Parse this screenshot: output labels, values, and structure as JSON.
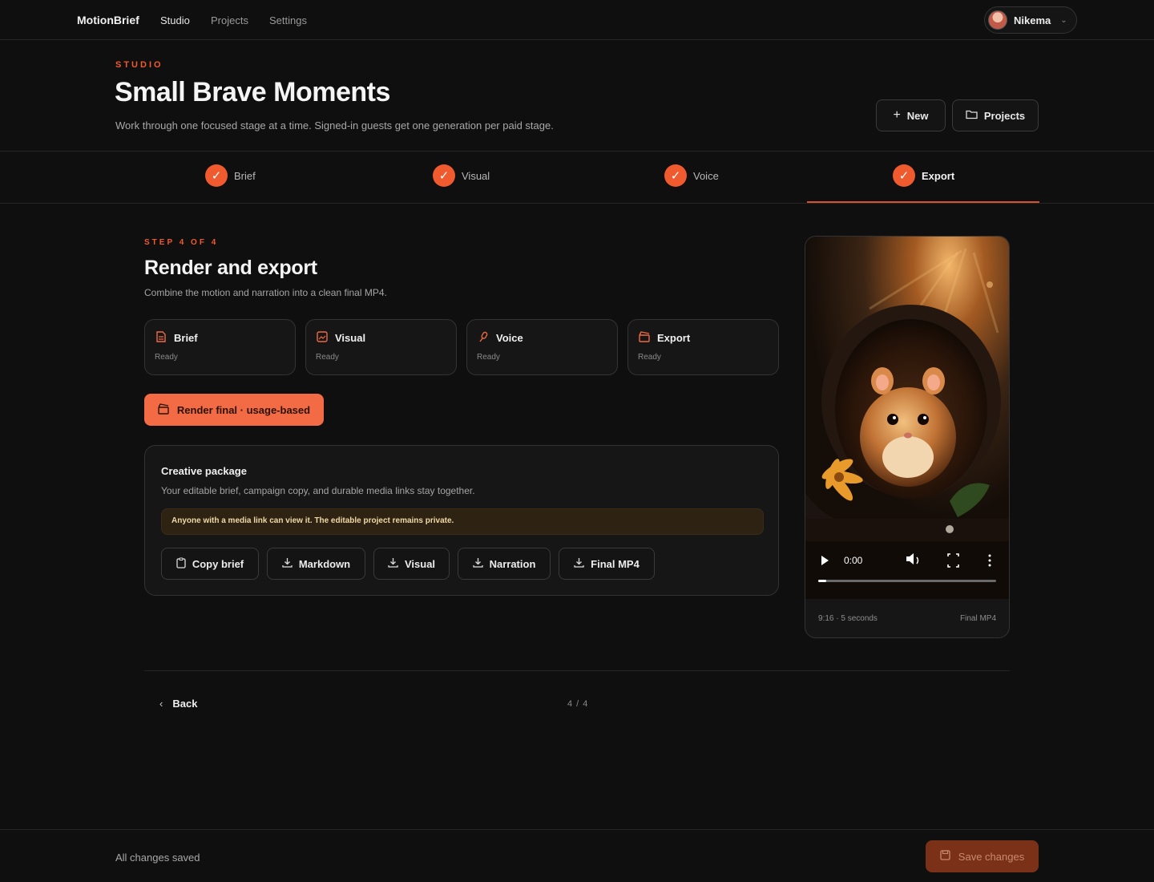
{
  "nav": {
    "brand": "MotionBrief",
    "links": [
      "Studio",
      "Projects",
      "Settings"
    ],
    "user": {
      "name": "Nikema"
    }
  },
  "header": {
    "eyebrow": "STUDIO",
    "title": "Small Brave Moments",
    "subtitle": "Work through one focused stage at a time. Signed-in guests get one generation per paid stage.",
    "new_label": "New",
    "projects_label": "Projects"
  },
  "steps": [
    {
      "label": "Brief"
    },
    {
      "label": "Visual"
    },
    {
      "label": "Voice"
    },
    {
      "label": "Export"
    }
  ],
  "main": {
    "eyebrow": "STEP 4 OF 4",
    "title": "Render and export",
    "description": "Combine the motion and narration into a clean final MP4.",
    "cards": [
      {
        "label": "Brief",
        "status": "Ready",
        "icon": "document-icon"
      },
      {
        "label": "Visual",
        "status": "Ready",
        "icon": "image-icon"
      },
      {
        "label": "Voice",
        "status": "Ready",
        "icon": "microphone-icon"
      },
      {
        "label": "Export",
        "status": "Ready",
        "icon": "clapperboard-icon"
      }
    ],
    "render_label": "Render final · usage-based",
    "package": {
      "title": "Creative package",
      "description": "Your editable brief, campaign copy, and durable media links stay together.",
      "notice": "Anyone with a media link can view it. The editable project remains private.",
      "buttons": [
        "Copy brief",
        "Markdown",
        "Visual",
        "Narration",
        "Final MP4"
      ]
    }
  },
  "video": {
    "time": "0:00",
    "meta_left": "9:16 · 5 seconds",
    "meta_right": "Final MP4"
  },
  "pager": {
    "back_label": "Back",
    "position": "4 / 4"
  },
  "footer": {
    "status": "All changes saved",
    "save_label": "Save changes"
  },
  "colors": {
    "accent": "#ef5a2e",
    "background": "#0f0f0f",
    "card": "#161616"
  }
}
